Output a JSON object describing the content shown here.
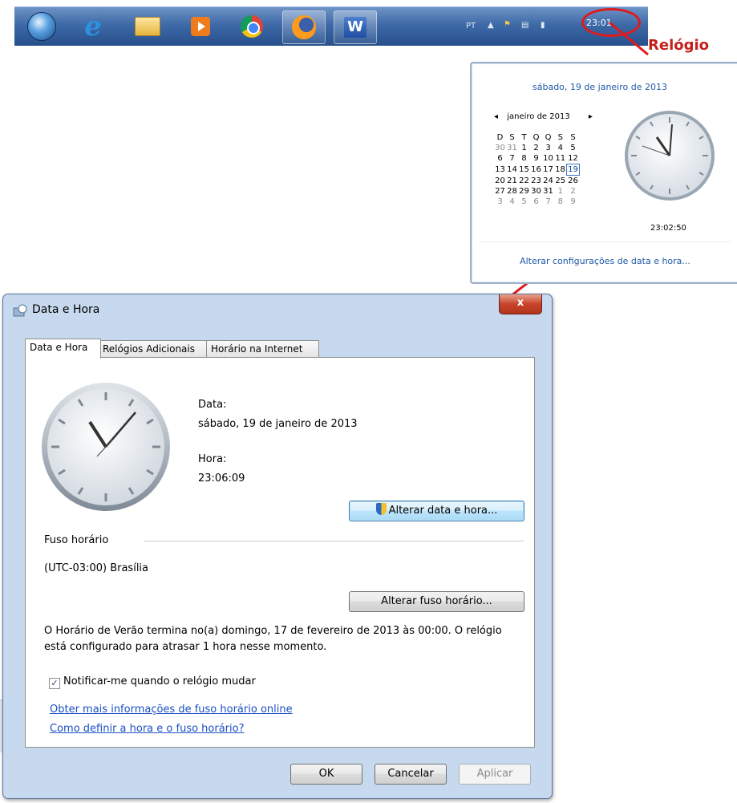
{
  "taskbar": {
    "items": [
      {
        "name": "start-orb-icon"
      },
      {
        "name": "internet-explorer-icon",
        "glyph": "e"
      },
      {
        "name": "folder-icon"
      },
      {
        "name": "media-player-icon"
      },
      {
        "name": "chrome-icon"
      },
      {
        "name": "firefox-icon"
      },
      {
        "name": "word-icon",
        "glyph": "W"
      }
    ],
    "language": "PT",
    "clock_text": "23:01"
  },
  "annotation": {
    "label": "Relógio",
    "color": "#c4211c"
  },
  "calendar_popup": {
    "long_date": "sábado, 19 de janeiro de 2013",
    "month_label": "janeiro de 2013",
    "prev_arrow": "◂",
    "next_arrow": "▸",
    "weekdays": [
      "D",
      "S",
      "T",
      "Q",
      "Q",
      "S",
      "S"
    ],
    "weeks": [
      [
        "30",
        "31",
        "1",
        "2",
        "3",
        "4",
        "5"
      ],
      [
        "6",
        "7",
        "8",
        "9",
        "10",
        "11",
        "12"
      ],
      [
        "13",
        "14",
        "15",
        "16",
        "17",
        "18",
        "19"
      ],
      [
        "20",
        "21",
        "22",
        "23",
        "24",
        "25",
        "26"
      ],
      [
        "27",
        "28",
        "29",
        "30",
        "31",
        "1",
        "2"
      ],
      [
        "3",
        "4",
        "5",
        "6",
        "7",
        "8",
        "9"
      ]
    ],
    "today": "19",
    "time": "23:02:50",
    "settings_link": "Alterar configurações de data e hora..."
  },
  "dialog": {
    "title": "Data e Hora",
    "close_label": "x",
    "tabs": [
      "Data e Hora",
      "Relógios Adicionais",
      "Horário na Internet"
    ],
    "date_label": "Data:",
    "date_value": "sábado, 19 de janeiro de 2013",
    "time_label": "Hora:",
    "time_value": "23:06:09",
    "change_datetime_button": "Alterar data e hora...",
    "timezone_header": "Fuso horário",
    "timezone_value": "(UTC-03:00) Brasília",
    "change_timezone_button": "Alterar fuso horário...",
    "dst_line1": "O Horário de Verão termina no(a) domingo, 17 de fevereiro de 2013 às 00:00. O relógio",
    "dst_line2": "está configurado para atrasar 1 hora nesse momento.",
    "notify_checkbox_label": "Notificar-me quando o relógio mudar",
    "notify_checked": true,
    "link_more_info": "Obter mais informações de fuso horário online",
    "link_how_to": "Como definir a hora e o fuso horário?",
    "ok_button": "OK",
    "cancel_button": "Cancelar",
    "apply_button": "Aplicar"
  },
  "colors": {
    "link": "#1a4fc4",
    "popup_text": "#1f5aa8",
    "highlight_red": "#e01a1a",
    "taskbar": "#3e6aa8"
  }
}
